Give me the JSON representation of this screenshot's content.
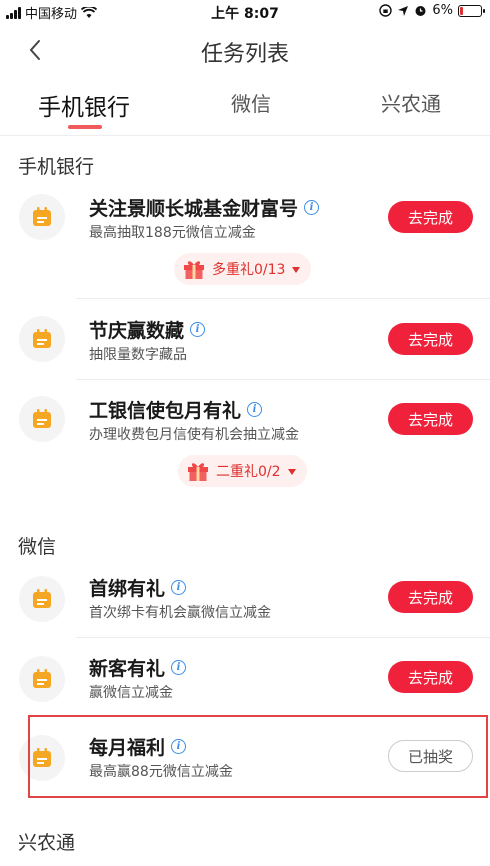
{
  "status_bar": {
    "carrier": "中国移动",
    "time": "上午 8:07",
    "battery": "6%"
  },
  "nav": {
    "title": "任务列表"
  },
  "tabs": [
    {
      "label": "手机银行"
    },
    {
      "label": "微信"
    },
    {
      "label": "兴农通"
    }
  ],
  "sections": {
    "mobile_bank": {
      "title": "手机银行",
      "tasks": [
        {
          "title": "关注景顺长城基金财富号",
          "subtitle": "最高抽取188元微信立减金",
          "button": "去完成",
          "gift": "多重礼0/13"
        },
        {
          "title": "节庆赢数藏",
          "subtitle": "抽限量数字藏品",
          "button": "去完成"
        },
        {
          "title": "工银信使包月有礼",
          "subtitle": "办理收费包月信使有机会抽立减金",
          "button": "去完成",
          "gift": "二重礼0/2"
        }
      ]
    },
    "wechat": {
      "title": "微信",
      "tasks": [
        {
          "title": "首绑有礼",
          "subtitle": "首次绑卡有机会赢微信立减金",
          "button": "去完成"
        },
        {
          "title": "新客有礼",
          "subtitle": "赢微信立减金",
          "button": "去完成"
        },
        {
          "title": "每月福利",
          "subtitle": "最高赢88元微信立减金",
          "button": "已抽奖"
        }
      ]
    },
    "xingnongtong": {
      "title": "兴农通"
    }
  },
  "colors": {
    "accent": "#f0213a",
    "icon": "#f5a623",
    "info": "#3a8ee6",
    "highlight": "#e04444"
  }
}
